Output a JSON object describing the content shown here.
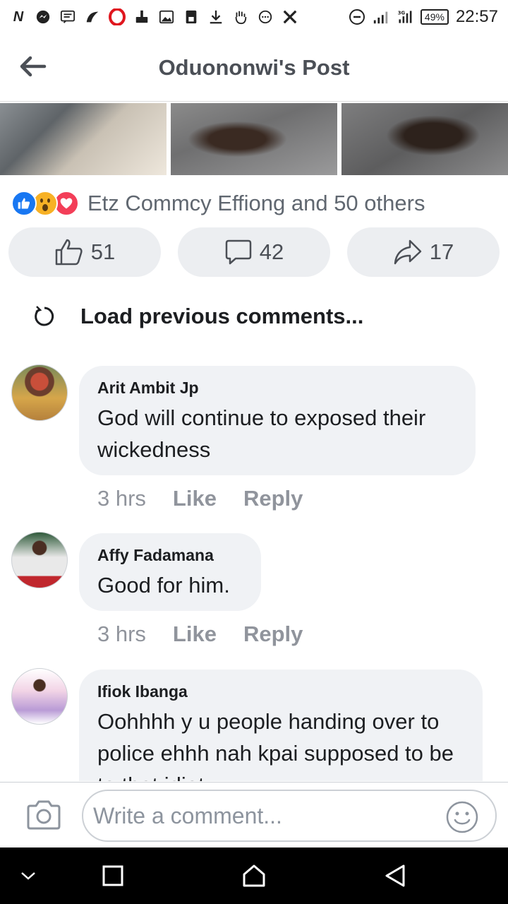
{
  "status_bar": {
    "battery": "49%",
    "time": "22:57",
    "icons": [
      "n-app-icon",
      "messenger-icon",
      "message-icon",
      "app-icon",
      "opera-icon",
      "cleaner-icon",
      "image-icon",
      "save-icon",
      "download-icon",
      "hand-icon",
      "chat-icon",
      "x-icon",
      "dnd-icon",
      "signal-icon",
      "signal-3g-icon"
    ]
  },
  "header": {
    "title": "Oduononwi's Post"
  },
  "reactions": {
    "types": [
      "like",
      "wow",
      "love"
    ],
    "summary": "Etz Commcy Effiong and 50 others"
  },
  "actions": {
    "likes": "51",
    "comments": "42",
    "shares": "17"
  },
  "load_previous": "Load previous comments...",
  "comments": [
    {
      "author": "Arit Ambit Jp",
      "text": "God will continue to exposed their wickedness",
      "time": "3 hrs",
      "like": "Like",
      "reply": "Reply"
    },
    {
      "author": "Affy Fadamana",
      "text": "Good for him.",
      "time": "3 hrs",
      "like": "Like",
      "reply": "Reply"
    },
    {
      "author": "Ifiok Ibanga",
      "text": "Oohhhh y u people handing over to police ehhh nah kpai supposed to be to that idiot"
    }
  ],
  "composer": {
    "placeholder": "Write a comment..."
  },
  "colors": {
    "like_blue": "#1877f2",
    "wow_yellow": "#f7b125",
    "love_red": "#f33e58",
    "bubble_bg": "#f0f2f5",
    "button_bg": "#eceef1"
  }
}
